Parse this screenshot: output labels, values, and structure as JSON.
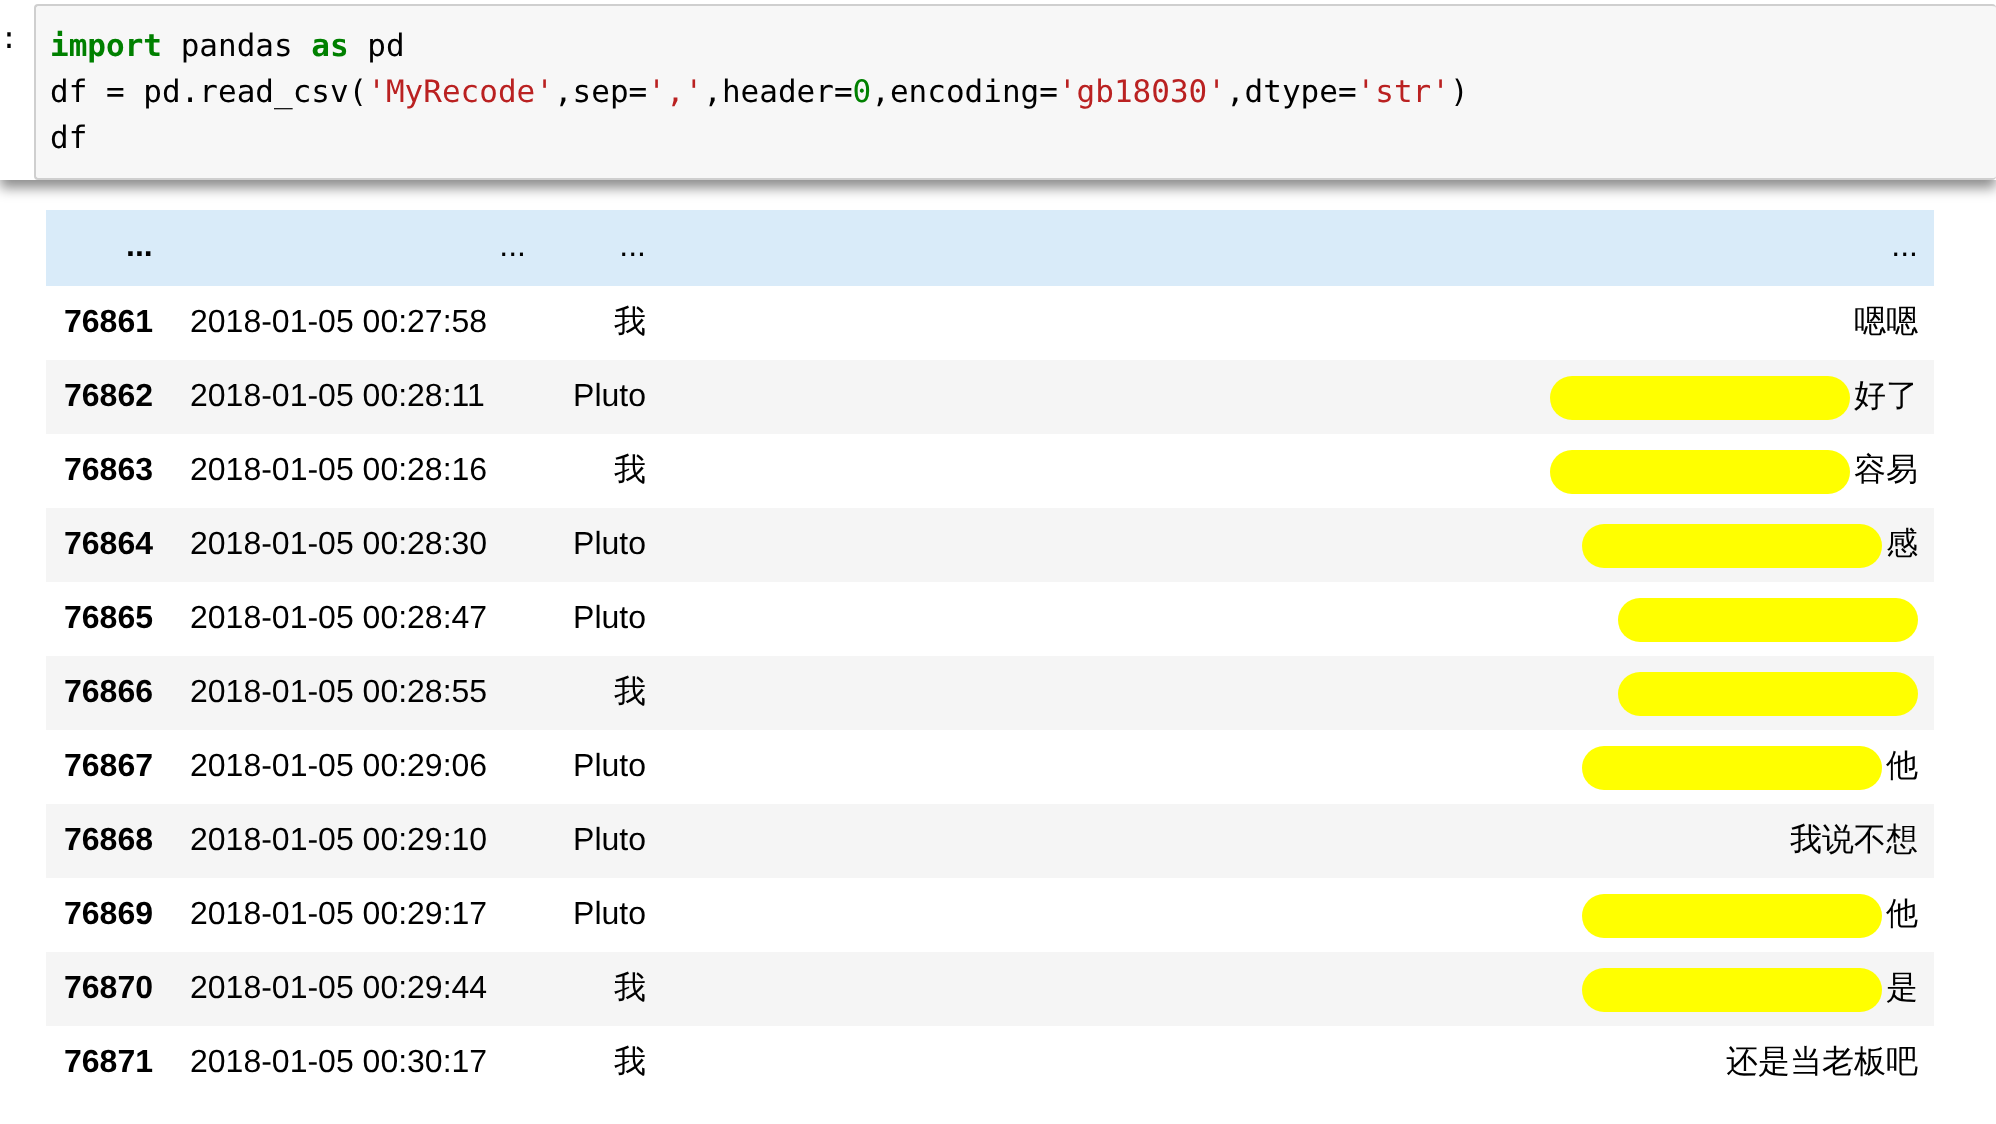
{
  "code_cell": {
    "prompt": ":",
    "lines": [
      [
        {
          "kind": "keyword",
          "text": "import"
        },
        {
          "kind": "plain",
          "text": " pandas "
        },
        {
          "kind": "keyword",
          "text": "as"
        },
        {
          "kind": "plain",
          "text": " pd"
        }
      ],
      [
        {
          "kind": "plain",
          "text": "df = pd.read_csv("
        },
        {
          "kind": "string",
          "text": "'MyRecode'"
        },
        {
          "kind": "plain",
          "text": ",sep="
        },
        {
          "kind": "string",
          "text": "','"
        },
        {
          "kind": "plain",
          "text": ",header="
        },
        {
          "kind": "number",
          "text": "0"
        },
        {
          "kind": "plain",
          "text": ",encoding="
        },
        {
          "kind": "string",
          "text": "'gb18030'"
        },
        {
          "kind": "plain",
          "text": ",dtype="
        },
        {
          "kind": "string",
          "text": "'str'"
        },
        {
          "kind": "plain",
          "text": ")"
        }
      ],
      [
        {
          "kind": "plain",
          "text": "df"
        }
      ]
    ]
  },
  "table": {
    "rows": [
      {
        "kind": "ellipsis",
        "index": "...",
        "time": "...",
        "speaker": "...",
        "message": "...",
        "redacted": false
      },
      {
        "kind": "data",
        "index": "76861",
        "time": "2018-01-05 00:27:58",
        "speaker": "我",
        "message": "嗯嗯",
        "redacted": false
      },
      {
        "kind": "data",
        "index": "76862",
        "time": "2018-01-05 00:28:11",
        "speaker": "Pluto",
        "message": "好了",
        "redacted": true
      },
      {
        "kind": "data",
        "index": "76863",
        "time": "2018-01-05 00:28:16",
        "speaker": "我",
        "message": "容易",
        "redacted": true
      },
      {
        "kind": "data",
        "index": "76864",
        "time": "2018-01-05 00:28:30",
        "speaker": "Pluto",
        "message": "感",
        "redacted": true
      },
      {
        "kind": "data",
        "index": "76865",
        "time": "2018-01-05 00:28:47",
        "speaker": "Pluto",
        "message": "",
        "redacted": true
      },
      {
        "kind": "data",
        "index": "76866",
        "time": "2018-01-05 00:28:55",
        "speaker": "我",
        "message": "",
        "redacted": true
      },
      {
        "kind": "data",
        "index": "76867",
        "time": "2018-01-05 00:29:06",
        "speaker": "Pluto",
        "message": "他",
        "redacted": true
      },
      {
        "kind": "data",
        "index": "76868",
        "time": "2018-01-05 00:29:10",
        "speaker": "Pluto",
        "message": "我说不想",
        "redacted": false
      },
      {
        "kind": "data",
        "index": "76869",
        "time": "2018-01-05 00:29:17",
        "speaker": "Pluto",
        "message": "他",
        "redacted": true
      },
      {
        "kind": "data",
        "index": "76870",
        "time": "2018-01-05 00:29:44",
        "speaker": "我",
        "message": "是",
        "redacted": true
      },
      {
        "kind": "data",
        "index": "76871",
        "time": "2018-01-05 00:30:17",
        "speaker": "我",
        "message": "还是当老板吧",
        "redacted": false
      }
    ]
  }
}
